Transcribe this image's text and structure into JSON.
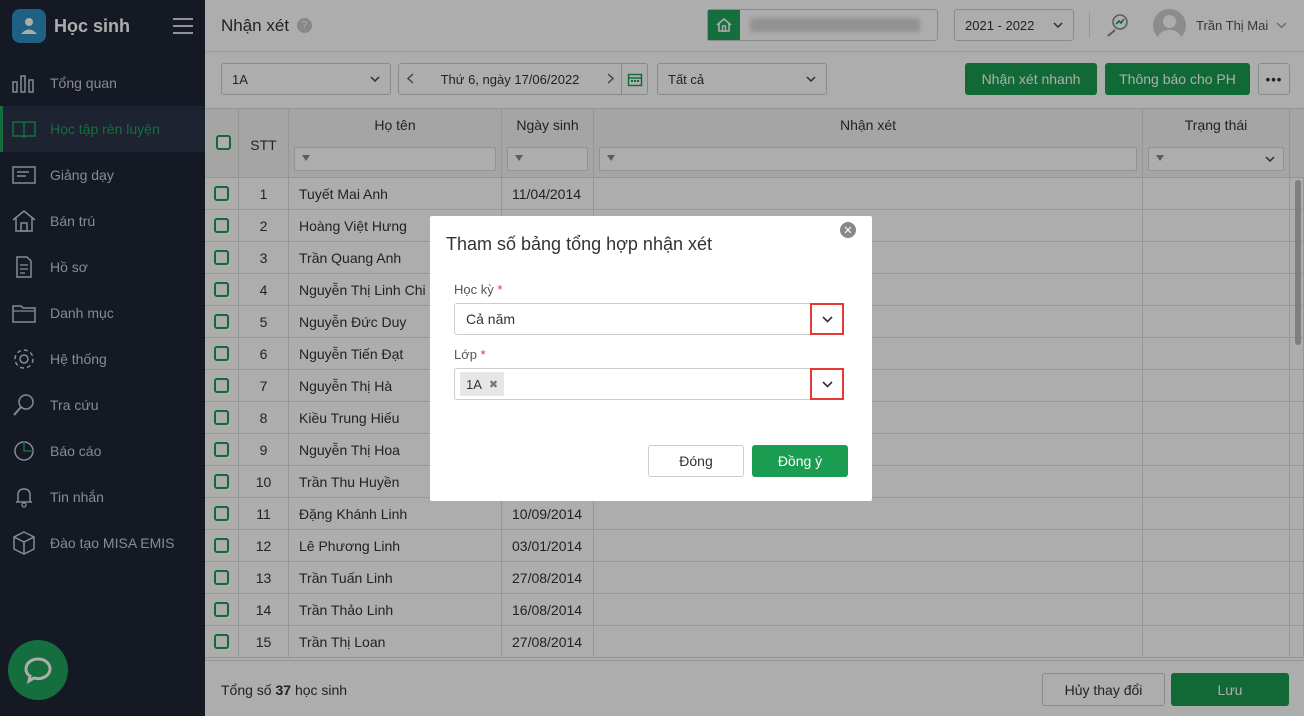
{
  "app": {
    "title": "Học sinh"
  },
  "sidebar": {
    "items": [
      {
        "label": "Tổng quan",
        "icon": "chart-bars-icon"
      },
      {
        "label": "Học tập rèn luyện",
        "icon": "book-icon",
        "active": true
      },
      {
        "label": "Giảng dạy",
        "icon": "board-icon"
      },
      {
        "label": "Bán trú",
        "icon": "house-icon"
      },
      {
        "label": "Hồ sơ",
        "icon": "document-icon"
      },
      {
        "label": "Danh mục",
        "icon": "folder-icon"
      },
      {
        "label": "Hệ thống",
        "icon": "gear-icon"
      },
      {
        "label": "Tra cứu",
        "icon": "search-icon"
      },
      {
        "label": "Báo cáo",
        "icon": "pie-chart-icon"
      },
      {
        "label": "Tin nhắn",
        "icon": "bell-icon"
      },
      {
        "label": "Đào tạo MISA EMIS",
        "icon": "box-icon"
      }
    ]
  },
  "header": {
    "title": "Nhận xét",
    "help": "?",
    "year": "2021 - 2022",
    "user": "Trần Thị Mai"
  },
  "toolbar": {
    "class": "1A",
    "date": "Thứ 6, ngày 17/06/2022",
    "status": "Tất cả",
    "quick_comment": "Nhận xét nhanh",
    "notify_parents": "Thông báo cho PH",
    "more": "•••"
  },
  "table": {
    "headers": {
      "stt": "STT",
      "name": "Họ tên",
      "dob": "Ngày sinh",
      "comment": "Nhận xét",
      "status": "Trạng thái"
    },
    "rows": [
      {
        "stt": "1",
        "name": "Tuyết Mai Anh",
        "dob": "11/04/2014"
      },
      {
        "stt": "2",
        "name": "Hoàng Việt Hưng",
        "dob": ""
      },
      {
        "stt": "3",
        "name": "Trần Quang Anh",
        "dob": ""
      },
      {
        "stt": "4",
        "name": "Nguyễn Thị Linh Chi",
        "dob": ""
      },
      {
        "stt": "5",
        "name": "Nguyễn Đức Duy",
        "dob": ""
      },
      {
        "stt": "6",
        "name": "Nguyễn Tiến Đạt",
        "dob": ""
      },
      {
        "stt": "7",
        "name": "Nguyễn Thị Hà",
        "dob": ""
      },
      {
        "stt": "8",
        "name": "Kiều Trung Hiếu",
        "dob": ""
      },
      {
        "stt": "9",
        "name": "Nguyễn Thị Hoa",
        "dob": ""
      },
      {
        "stt": "10",
        "name": "Trần Thu Huyền",
        "dob": ""
      },
      {
        "stt": "11",
        "name": "Đặng Khánh Linh",
        "dob": "10/09/2014"
      },
      {
        "stt": "12",
        "name": "Lê Phương Linh",
        "dob": "03/01/2014"
      },
      {
        "stt": "13",
        "name": "Trần Tuấn Linh",
        "dob": "27/08/2014"
      },
      {
        "stt": "14",
        "name": "Trần Thảo Linh",
        "dob": "16/08/2014"
      },
      {
        "stt": "15",
        "name": "Trần Thị Loan",
        "dob": "27/08/2014"
      }
    ]
  },
  "footer": {
    "total_prefix": "Tổng số",
    "total_count": "37",
    "total_suffix": "học sinh",
    "cancel_label": "Hủy thay đổi",
    "save_label": "Lưu"
  },
  "modal": {
    "title": "Tham số bảng tổng hợp nhận xét",
    "semester_label": "Học kỳ",
    "semester_value": "Cả năm",
    "class_label": "Lớp",
    "class_tag": "1A",
    "required_mark": "*",
    "close_label": "Đóng",
    "ok_label": "Đồng ý"
  },
  "colors": {
    "accent": "#1a9d50",
    "sidebar": "#1f2636",
    "highlight": "#e53935"
  }
}
